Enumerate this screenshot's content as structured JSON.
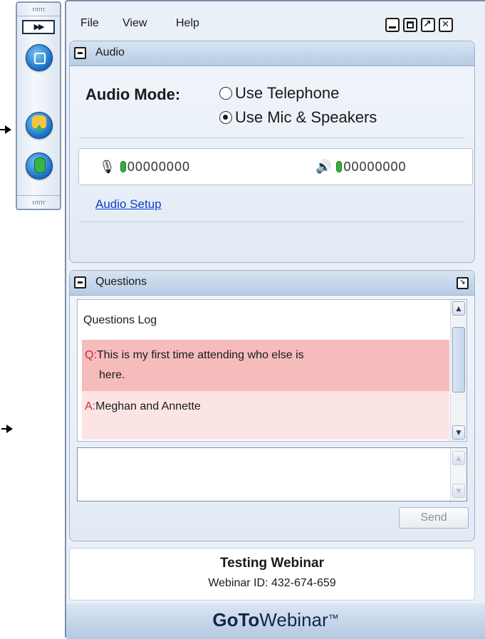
{
  "menu": {
    "file": "File",
    "view": "View",
    "help": "Help"
  },
  "audio_panel": {
    "title": "Audio",
    "mode_label": "Audio Mode:",
    "options": [
      {
        "label": "Use Telephone",
        "selected": false
      },
      {
        "label": "Use Mic & Speakers",
        "selected": true
      }
    ],
    "mic_level": "00000000",
    "speaker_level": "00000000",
    "setup_link": "Audio Setup"
  },
  "questions_panel": {
    "title": "Questions",
    "log_title": "Questions Log",
    "entries": [
      {
        "tag": "Q:",
        "text": "This is my first time attending who else is",
        "text_cont": "here."
      },
      {
        "tag": "A:",
        "text": "Meghan and Annette"
      }
    ],
    "input_value": "",
    "send_label": "Send"
  },
  "webinar": {
    "name": "Testing Webinar",
    "id_text": "Webinar ID: 432-674-659"
  },
  "brand": {
    "bold": "GoTo",
    "rest": "Webinar",
    "mark": "™"
  },
  "icons": {
    "fast_forward": "fast-forward-icon",
    "screen": "screen-icon",
    "raise_hand": "raise-hand-icon",
    "microphone": "microphone-icon",
    "speaker": "speaker-icon"
  },
  "colors": {
    "accent": "#1b72c8",
    "link": "#0b3dcc",
    "question_bg": "#f6bcbc",
    "answer_bg": "#fde4e4"
  }
}
